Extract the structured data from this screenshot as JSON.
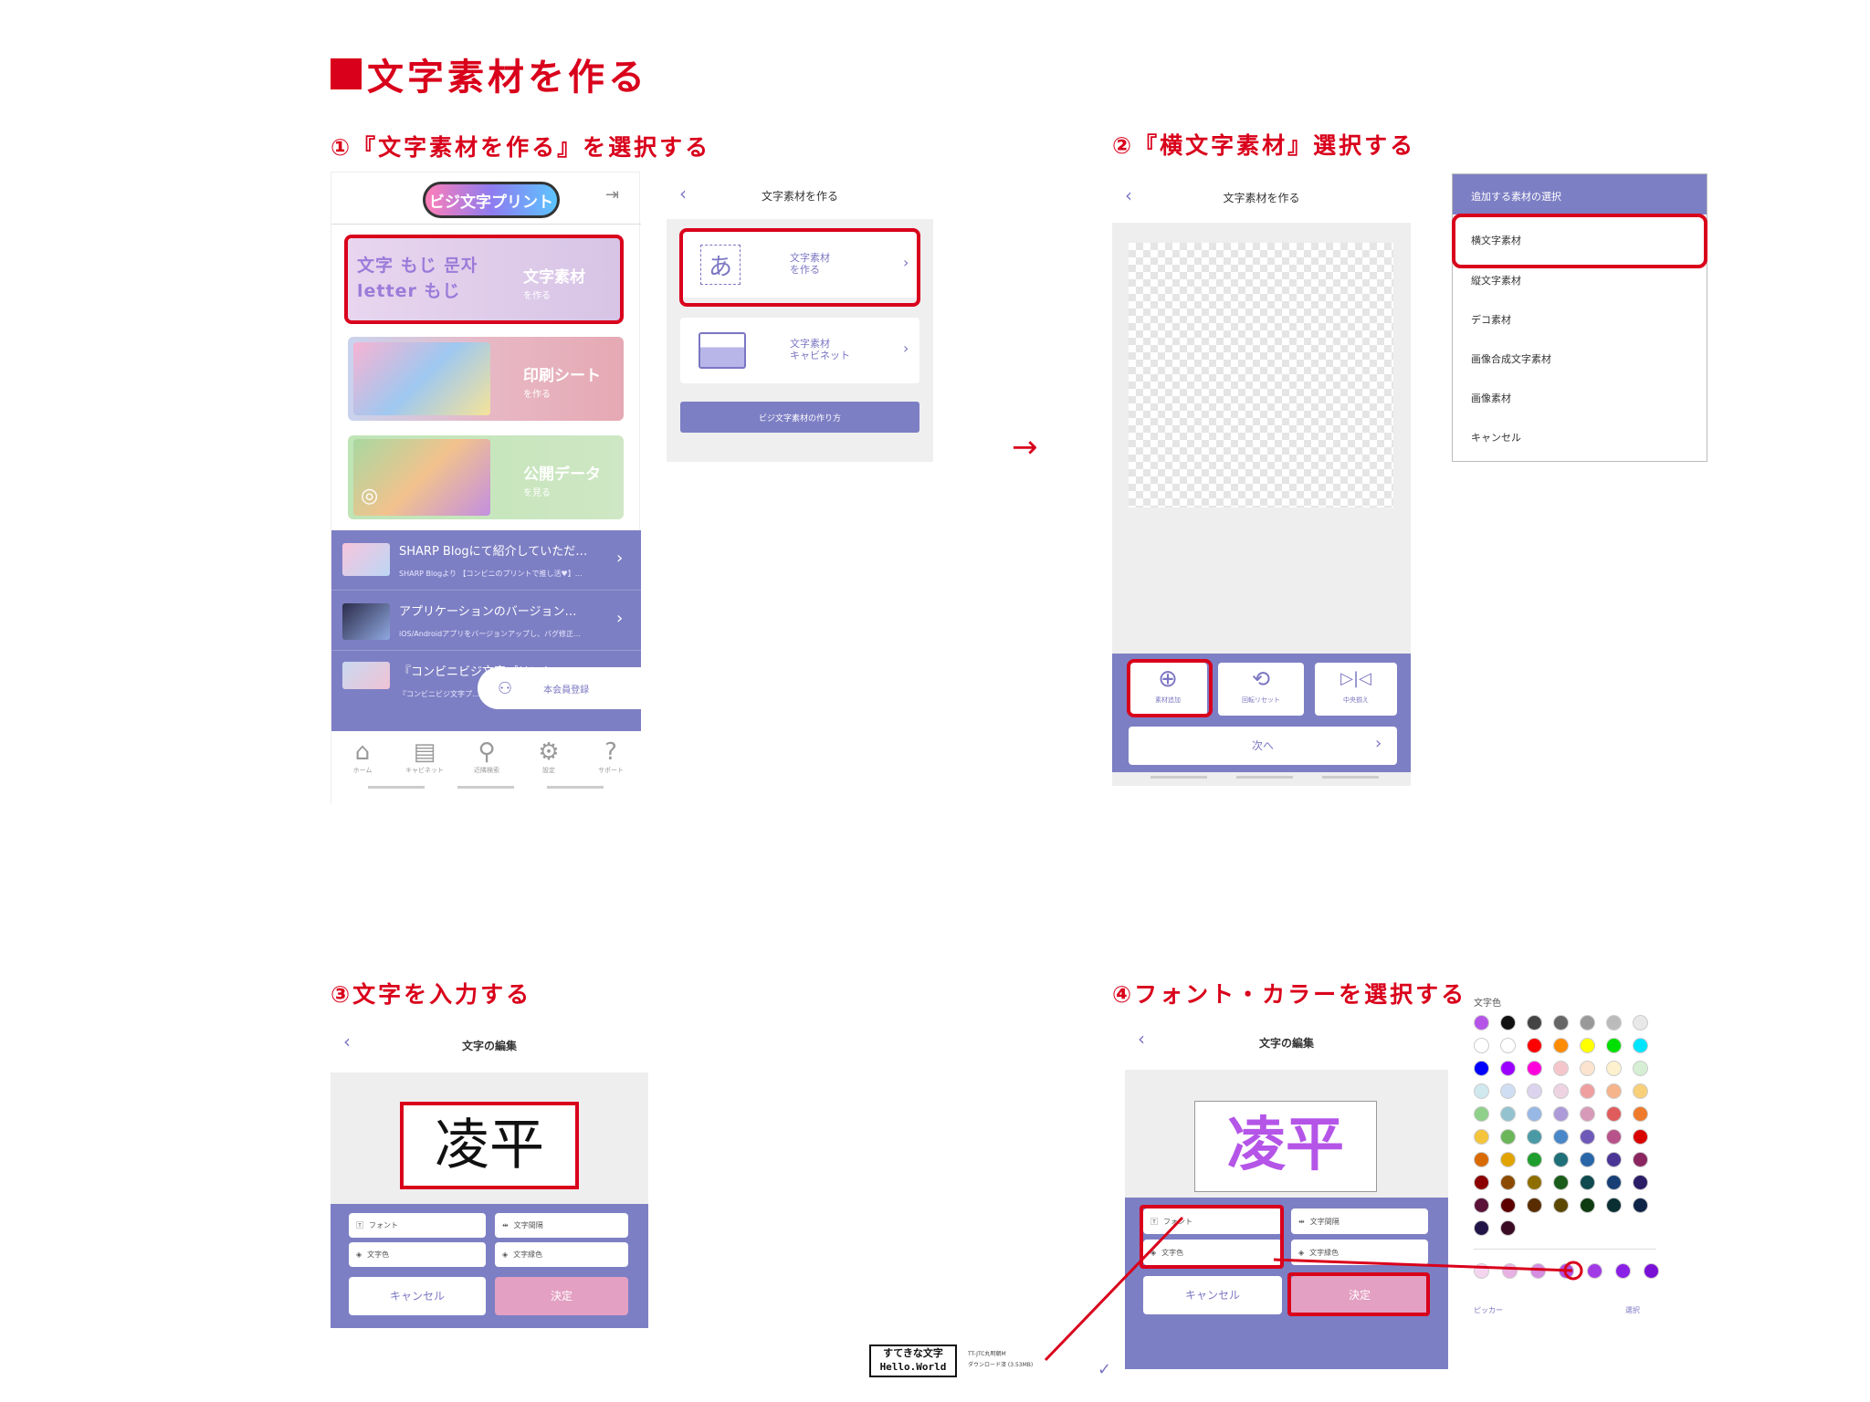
{
  "title": "文字素材を作る",
  "steps": {
    "s1": "①『文字素材を作る』を選択する",
    "s2": "②『横文字素材』選択する",
    "s3": "③文字を入力する",
    "s4": "④フォント・カラーを選択する"
  },
  "arrow": "→",
  "home": {
    "logo": "ビジ文字プリント",
    "menu_cards": [
      {
        "label": "文字素材",
        "sub": "を作る",
        "art": "文字 もじ 문자 letter もじ"
      },
      {
        "label": "印刷シート",
        "sub": "を作る"
      },
      {
        "label": "公開データ",
        "sub": "を見る"
      }
    ],
    "news": [
      {
        "title": "SHARP Blogにて紹介していただ…",
        "sub": "SHARP Blogより 【コンビニのプリントで推し活♥】…"
      },
      {
        "title": "アプリケーションのバージョン…",
        "sub": "iOS/Androidアプリをバージョンアップし、バグ修正…"
      },
      {
        "title": "『コンビニビジ文字プリント』…",
        "sub": "『コンビニビジ文字プ…"
      }
    ],
    "member_button": "本会員登録",
    "nav": [
      "ホーム",
      "キャビネット",
      "近隣検索",
      "設定",
      "サポート"
    ]
  },
  "create_menu": {
    "header": "文字素材を作る",
    "items": [
      {
        "label": "文字素材\nを作る",
        "icon": "あ"
      },
      {
        "label": "文字素材\nキャビネット"
      }
    ],
    "howto_button": "ビジ文字素材の作り方"
  },
  "editor": {
    "header": "文字素材を作る",
    "tools": [
      "素材追加",
      "回転リセット",
      "中央揃え"
    ],
    "next_button": "次へ"
  },
  "select_panel": {
    "header": "追加する素材の選択",
    "items": [
      "横文字素材",
      "縦文字素材",
      "デコ素材",
      "画像合成文字素材",
      "画像素材",
      "キャンセル"
    ]
  },
  "text_edit": {
    "header": "文字の編集",
    "text": "凌平",
    "buttons": [
      "フォント",
      "文字間隔",
      "文字色",
      "文字縁色"
    ],
    "cancel": "キャンセル",
    "ok": "決定"
  },
  "text_edit2": {
    "header": "文字の編集",
    "text": "凌平",
    "buttons": [
      "フォント",
      "文字間隔",
      "文字色",
      "文字縁色"
    ],
    "cancel": "キャンセル",
    "ok": "決定"
  },
  "font_sample": {
    "line1": "すてきな文字",
    "line2": "Hello.World",
    "meta1": "TT-JTC丸明朝M",
    "meta2": "ダウンロード済 (3.53MB)"
  },
  "palette": {
    "label": "文字色",
    "picker": "ピッカー",
    "select": "選択",
    "rows": [
      [
        "#b455e8",
        "#111111",
        "#444444",
        "#666666",
        "#999999",
        "#bbbbbb",
        "#e8e8e8"
      ],
      [
        "#ffffff",
        "#ffffff",
        "#ff0000",
        "#ff8c00",
        "#ffff00",
        "#00e000",
        "#00e5ff"
      ],
      [
        "#0000ff",
        "#9b00ff",
        "#ff00dd",
        "#f4c6cc",
        "#fbe3cf",
        "#fdf2cd",
        "#d6efd4"
      ],
      [
        "#cfe9ef",
        "#cfdef3",
        "#dcd3ee",
        "#eed3e3",
        "#ef9f9f",
        "#f6b48a",
        "#f8d07a"
      ],
      [
        "#8fd08a",
        "#93c3cf",
        "#97b8e5",
        "#ad9ad8",
        "#d79ab8",
        "#e05c5c",
        "#ee7a2b"
      ],
      [
        "#f4c43a",
        "#6ab658",
        "#4a9aa6",
        "#4a87c9",
        "#6e58b8",
        "#b8528a",
        "#d90000"
      ],
      [
        "#d96a00",
        "#e0a300",
        "#1f9e2e",
        "#1f6f78",
        "#2866a8",
        "#4a3597",
        "#8a2560"
      ],
      [
        "#8b0000",
        "#8c4a00",
        "#8f6e00",
        "#1a5c1a",
        "#0f4a50",
        "#183f75",
        "#2b1c66"
      ],
      [
        "#5a1238",
        "#5c0000",
        "#5a2d00",
        "#5c4700",
        "#0e3b10",
        "#0a2f33",
        "#0f2548"
      ],
      [
        "#221447",
        "#3b0b24"
      ]
    ],
    "recent": [
      "#f4d5ef",
      "#e7b2e3",
      "#d58ee1",
      "#b14ee0",
      "#a13be6",
      "#8a1fe8",
      "#7a0fd6"
    ]
  }
}
